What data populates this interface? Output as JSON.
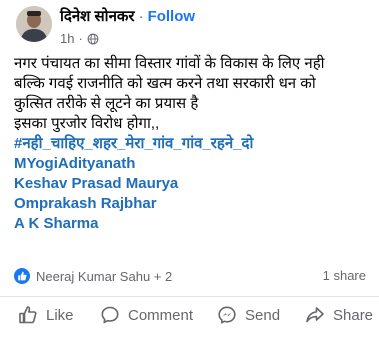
{
  "post": {
    "author": "दिनेश सोनकर",
    "separator": "·",
    "follow_label": "Follow",
    "time": "1h",
    "separator2": "·",
    "text_lines": [
      "नगर पंचायत का सीमा विस्तार गांवों के विकास के लिए नही",
      "बल्कि गवई राजनीति को खत्म करने तथा सरकारी धन को",
      "कुत्सित तरीके से लूटने का प्रयास है",
      "इसका पुरजोर विरोध होगा,,"
    ],
    "tags": [
      "#नही_चाहिए_शहर_मेरा_गांव_गांव_रहने_दो",
      "MYogiAdityanath",
      "Keshav Prasad Maurya",
      "Omprakash Rajbhar",
      "A K Sharma"
    ]
  },
  "reactions": {
    "names": "Neeraj Kumar Sahu + 2",
    "shares": "1 share"
  },
  "actions": {
    "like": "Like",
    "comment": "Comment",
    "send": "Send",
    "share": "Share"
  },
  "colors": {
    "accent": "#1877f2",
    "tag": "#1e6fb8",
    "muted": "#65676b"
  }
}
